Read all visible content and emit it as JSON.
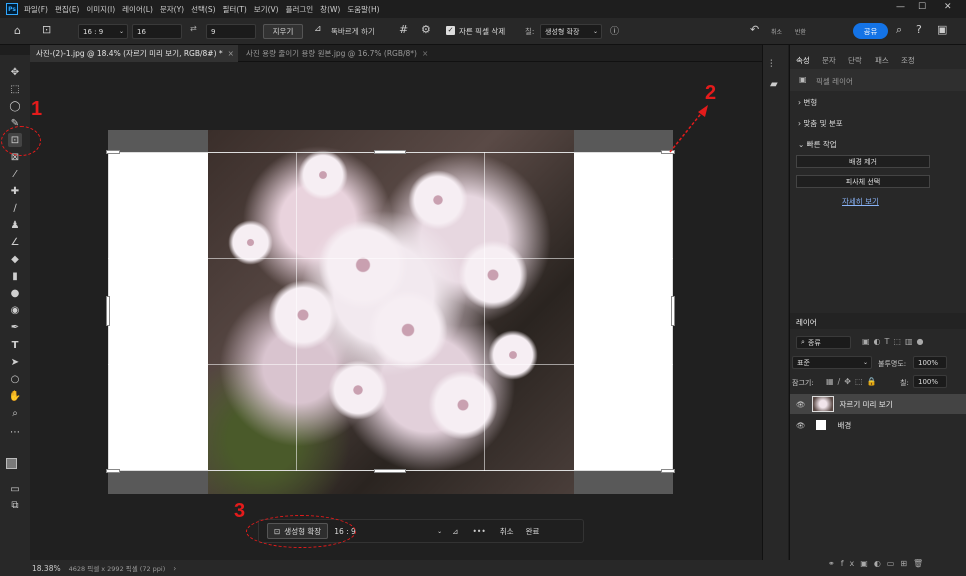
{
  "menu": {
    "items": [
      "파일(F)",
      "편집(E)",
      "이미지(I)",
      "레이어(L)",
      "문자(Y)",
      "선택(S)",
      "필터(T)",
      "보기(V)",
      "플러그인",
      "창(W)",
      "도움말(H)"
    ]
  },
  "window": {
    "minimize": "—",
    "maximize": "☐",
    "close": "✕"
  },
  "options": {
    "ratio": "16 : 9",
    "w_value": "16",
    "h_value": "9",
    "clear_label": "지우기",
    "straighten_label": "똑바르게 하기",
    "delete_pixels_label": "자른 픽셀 삭제",
    "fill_label": "칠:",
    "fill_value": "생성형 확장",
    "share_label": "공유",
    "undo_label": "취소",
    "redo_label": "반환"
  },
  "tabs": [
    {
      "label": "사진-(2)-1.jpg @ 18.4% (자르기 미리 보기, RGB/8#) *",
      "active": true
    },
    {
      "label": "사진 용량 줄이기 용량 원본.jpg @ 16.7% (RGB/8*)",
      "active": false
    }
  ],
  "status": {
    "zoom": "18.38%",
    "info": "4628 픽셀 x 2992 픽셀 (72 ppi)"
  },
  "properties": {
    "tabs": [
      "속성",
      "문자",
      "단락",
      "패스",
      "조정"
    ],
    "layer_type": "픽셀 레이어",
    "transform": "변형",
    "align": "맞춤 및 분포",
    "quick": "빠른 작업",
    "remove_bg": "배경 제거",
    "select_subject": "피사체 선택",
    "more": "자세히 보기"
  },
  "layers": {
    "title": "레이어",
    "search": "종류",
    "blend": "표준",
    "opacity_label": "불투명도:",
    "opacity": "100%",
    "lock_label": "잠그기:",
    "fill_label": "칠:",
    "fill": "100%",
    "items": [
      {
        "name": "자르기 미리 보기",
        "selected": true
      },
      {
        "name": "배경",
        "selected": false
      }
    ]
  },
  "context": {
    "generative": "생성형 확장",
    "ratio": "16 : 9",
    "cancel": "취소",
    "done": "완료",
    "more": "•••"
  },
  "annotations": {
    "a1": "1",
    "a2": "2",
    "a3": "3"
  },
  "colors": {
    "accent": "#1473e6",
    "annotation": "#e41b1b"
  }
}
